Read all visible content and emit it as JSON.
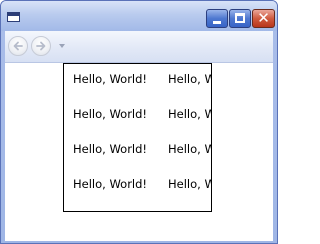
{
  "window": {
    "title": "",
    "controls": {
      "minimize": "minimize",
      "maximize": "maximize",
      "close": "close"
    }
  },
  "navigation": {
    "back_icon": "back-arrow-icon",
    "forward_icon": "forward-arrow-icon",
    "history_icon": "dropdown-arrow-icon"
  },
  "content": {
    "cells": [
      [
        "Hello, World!",
        "Hello, World!"
      ],
      [
        "Hello, World!",
        "Hello, World!"
      ],
      [
        "Hello, World!",
        "Hello, World!"
      ],
      [
        "Hello, World!",
        "Hello, World!"
      ]
    ]
  },
  "colors": {
    "title_close": "#cf5a3f",
    "title_buttons": "#4e78d0",
    "panel_border": "#000000"
  }
}
